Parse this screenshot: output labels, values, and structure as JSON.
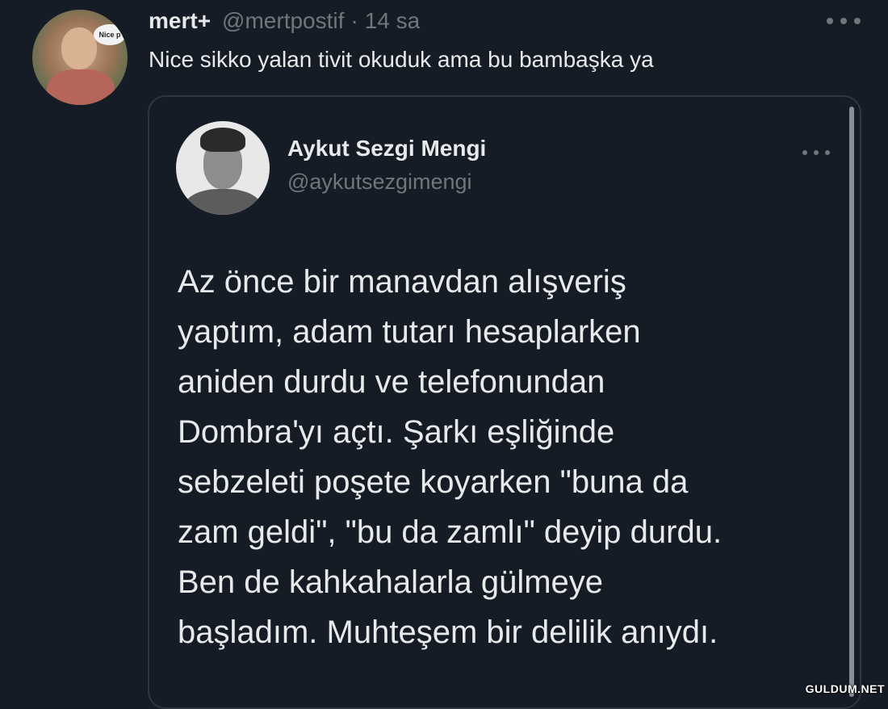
{
  "tweet": {
    "author_name": "mert+",
    "author_handle": "@mertpostif",
    "separator": "·",
    "time": "14 sa",
    "text": "Nice sikko yalan tivit okuduk ama bu bambaşka ya",
    "avatar_bubble_text": "Nice p"
  },
  "quoted_tweet": {
    "author_name": "Aykut Sezgi Mengi",
    "author_handle": "@aykutsezgimengi",
    "text_lines": [
      "Az önce bir manavdan alışveriş",
      "yaptım, adam tutarı hesaplarken",
      "aniden durdu ve telefonundan",
      "Dombra'yı açtı. Şarkı eşliğinde",
      "sebzeleti poşete koyarken \"buna da",
      "zam geldi\", \"bu da zamlı\" deyip durdu.",
      "Ben de kahkahalarla gülmeye",
      "başladım. Muhteşem bir delilik anıydı."
    ]
  },
  "icons": {
    "more_main": "more-horizontal-icon",
    "more_quote": "more-horizontal-icon"
  },
  "colors": {
    "background": "#161c26",
    "primary_text": "#e7e9ea",
    "secondary_text": "#71767b",
    "border": "#2f3640"
  },
  "watermark": "GULDUM.NET"
}
